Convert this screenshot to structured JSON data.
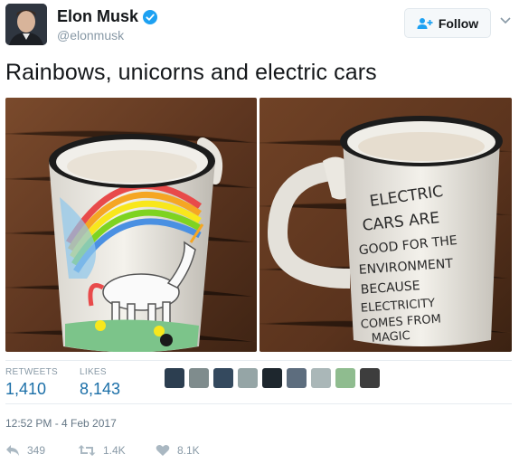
{
  "header": {
    "display_name": "Elon Musk",
    "handle": "@elonmusk",
    "follow_label": "Follow"
  },
  "tweet": {
    "text": "Rainbows, unicorns and electric cars",
    "mug_back_text": [
      "ELECTRIC",
      "CARS ARE",
      "GOOD FOR THE",
      "ENVIRONMENT",
      "BECAUSE",
      "ELECTRICITY",
      "COMES FROM",
      "MAGIC"
    ]
  },
  "stats": {
    "retweets_label": "RETWEETS",
    "retweets_value": "1,410",
    "likes_label": "LIKES",
    "likes_value": "8,143"
  },
  "timestamp": "12:52 PM - 4 Feb 2017",
  "actions": {
    "reply_count": "349",
    "retweet_count": "1.4K",
    "like_count": "8.1K"
  },
  "colors": {
    "link_blue": "#1b6fa8",
    "verified_blue": "#1da1f2",
    "muted_gray": "#8899a6"
  },
  "icons": [
    "verified-badge-icon",
    "follow-person-plus-icon",
    "chevron-down-icon",
    "reply-icon",
    "retweet-icon",
    "heart-icon"
  ]
}
